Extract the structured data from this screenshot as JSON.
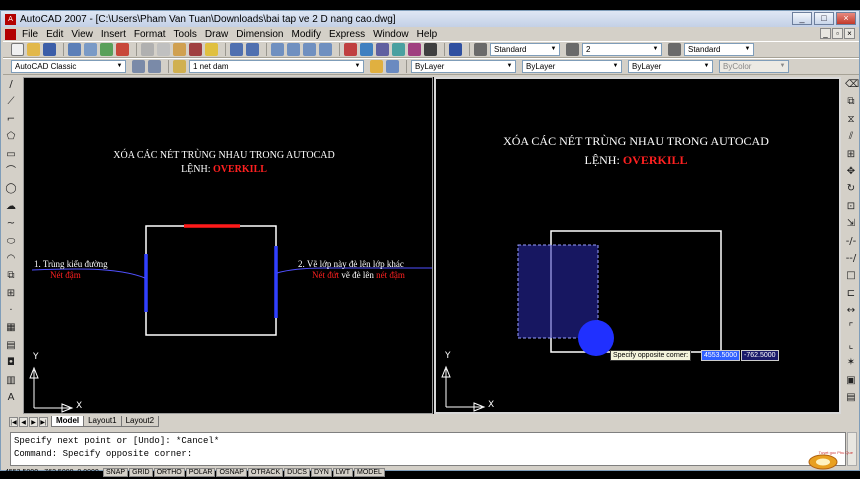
{
  "window": {
    "title": "AutoCAD 2007 - [C:\\Users\\Pham Van Tuan\\Downloads\\bai tap ve 2 D nang cao.dwg]",
    "controls": [
      "_",
      "□",
      "×"
    ]
  },
  "menubar": {
    "items": [
      "File",
      "Edit",
      "View",
      "Insert",
      "Format",
      "Tools",
      "Draw",
      "Dimension",
      "Modify",
      "Express",
      "Window",
      "Help"
    ],
    "mdi_controls": [
      "_",
      "▫",
      "×"
    ]
  },
  "toolbar1": {
    "text_style": "Standard",
    "dim_style": "2",
    "table_style": "Standard"
  },
  "toolbar2": {
    "workspace": "AutoCAD Classic",
    "layer": "1 net dam",
    "color": "ByLayer",
    "linetype": "ByLayer",
    "lineweight": "ByLayer",
    "plotstyle": "ByColor"
  },
  "left_viewport": {
    "title_line1": "XÓA CÁC NÉT TRÙNG NHAU TRONG AUTOCAD",
    "title_line2_prefix": "LỆNH: ",
    "title_line2_cmd": "OVERKILL",
    "note_left_line1": "1. Trùng kiểu đường",
    "note_left_line2": "Nét đậm",
    "note_right_line1": "2. Vẽ lớp này đè lên lớp khác",
    "note_right_line2_a": "Nét đứt",
    "note_right_line2_b": " vẽ đè lên ",
    "note_right_line2_c": "nét đậm",
    "ucs_y": "Y",
    "ucs_x": "X"
  },
  "right_viewport": {
    "title_line1": "XÓA CÁC NÉT TRÙNG NHAU TRONG AUTOCAD",
    "title_line2_prefix": "LỆNH: ",
    "title_line2_cmd": "OVERKILL",
    "tooltip": "Specify opposite corner:",
    "dyn_x": "4553.5000",
    "dyn_y": "-762.5000",
    "ucs_y": "Y",
    "ucs_x": "X"
  },
  "layout_tabs": {
    "nav": [
      "|◀",
      "◀",
      "▶",
      "▶|"
    ],
    "tabs": [
      "Model",
      "Layout1",
      "Layout2"
    ],
    "active": "Model"
  },
  "command_line": {
    "lines": [
      "Specify next point or [Undo]: *Cancel*",
      "",
      "Command: Specify opposite corner:"
    ]
  },
  "statusbar": {
    "coords": "4553.5000, -762.5000, 0.0000",
    "toggles": [
      "SNAP",
      "GRID",
      "ORTHO",
      "POLAR",
      "OSNAP",
      "OTRACK",
      "DUCS",
      "DYN",
      "LWT",
      "MODEL"
    ]
  },
  "watermark": {
    "text": "Tuyet goc Phu Que"
  },
  "colors": {
    "canvas": "#000000",
    "accent_red": "#ff2020",
    "crossing_window": "#2a2ab0"
  }
}
